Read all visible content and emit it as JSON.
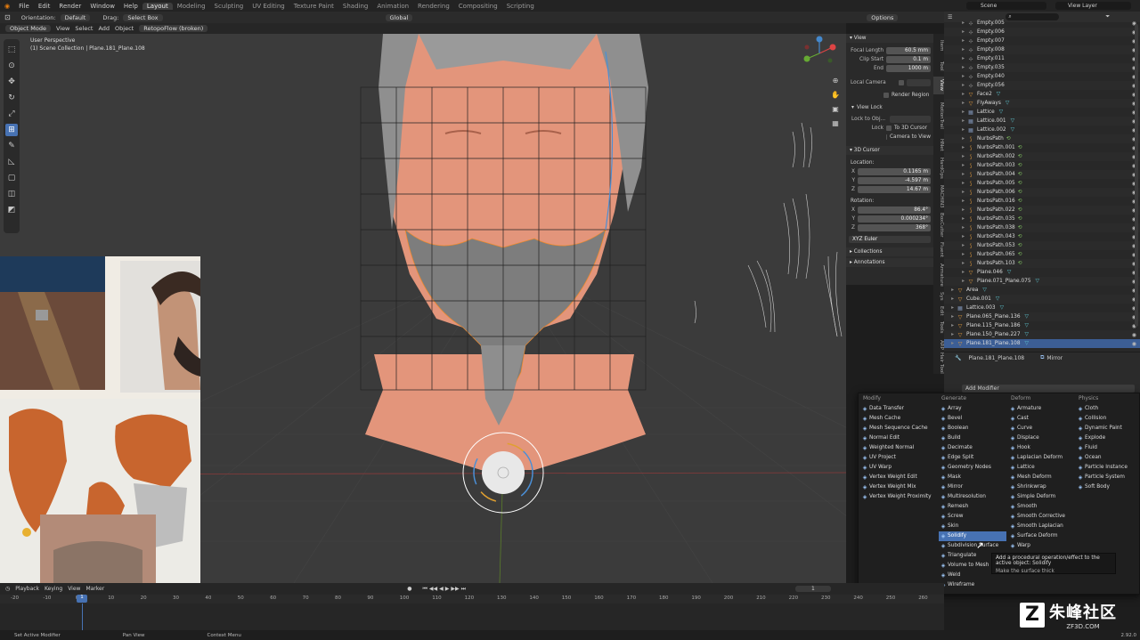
{
  "topbar": {
    "menus": [
      "File",
      "Edit",
      "Render",
      "Window",
      "Help"
    ],
    "workspaces": [
      "Layout",
      "Modeling",
      "Sculpting",
      "UV Editing",
      "Texture Paint",
      "Shading",
      "Animation",
      "Rendering",
      "Compositing",
      "Scripting"
    ],
    "active_workspace": "Layout",
    "scene": "Scene",
    "view_layer": "View Layer"
  },
  "header": {
    "orientation_label": "Orientation:",
    "orientation_value": "Default",
    "drag_label": "Drag:",
    "drag_value": "Select Box",
    "transform_space": "Global",
    "options": "Options"
  },
  "header2": {
    "mode": "Object Mode",
    "menus": [
      "View",
      "Select",
      "Add",
      "Object"
    ],
    "addon": "RetopoFlow (broken)"
  },
  "viewport": {
    "view_name": "User Perspective",
    "collection_info": "(1) Scene Collection | Plane.181_Plane.108"
  },
  "npanel": {
    "view_section": "View",
    "focal_length_label": "Focal Length",
    "focal_length": "60.5 mm",
    "clip_start_label": "Clip Start",
    "clip_start": "0.1 m",
    "clip_end_label": "End",
    "clip_end": "1000 m",
    "local_camera_label": "Local Camera",
    "render_region": "Render Region",
    "view_lock": "View Lock",
    "lock_to_obj_label": "Lock to Obj...",
    "lock_label": "Lock",
    "to_3d_cursor": "To 3D Cursor",
    "camera_to_view": "Camera to View",
    "cursor_section": "3D Cursor",
    "location_label": "Location:",
    "loc_x": "0.1165 m",
    "loc_y": "-4.597 m",
    "loc_z": "14.67 m",
    "rotation_label": "Rotation:",
    "rot_x": "86.4°",
    "rot_y": "0.000234°",
    "rot_z": "368°",
    "rotation_mode": "XYZ Euler",
    "collections": "Collections",
    "annotations": "Annotations"
  },
  "ntabs": [
    "Item",
    "Tool",
    "View",
    "MotionTrail",
    "HNet",
    "HardOps",
    "MACHIN3",
    "BoxCutter",
    "Fluent",
    "Armature",
    "Sys",
    "Edit",
    "Tools",
    "ARP",
    "Hair Tool"
  ],
  "outliner": {
    "items": [
      {
        "name": "Empty.005",
        "type": "empty"
      },
      {
        "name": "Empty.006",
        "type": "empty"
      },
      {
        "name": "Empty.007",
        "type": "empty"
      },
      {
        "name": "Empty.008",
        "type": "empty"
      },
      {
        "name": "Empty.011",
        "type": "empty"
      },
      {
        "name": "Empty.035",
        "type": "empty"
      },
      {
        "name": "Empty.040",
        "type": "empty"
      },
      {
        "name": "Empty.056",
        "type": "empty"
      },
      {
        "name": "Face2",
        "type": "mesh"
      },
      {
        "name": "FlyAways",
        "type": "mesh"
      },
      {
        "name": "Lattice",
        "type": "lattice"
      },
      {
        "name": "Lattice.001",
        "type": "lattice"
      },
      {
        "name": "Lattice.002",
        "type": "lattice"
      },
      {
        "name": "NurbsPath",
        "type": "curve"
      },
      {
        "name": "NurbsPath.001",
        "type": "curve"
      },
      {
        "name": "NurbsPath.002",
        "type": "curve"
      },
      {
        "name": "NurbsPath.003",
        "type": "curve"
      },
      {
        "name": "NurbsPath.004",
        "type": "curve"
      },
      {
        "name": "NurbsPath.005",
        "type": "curve"
      },
      {
        "name": "NurbsPath.006",
        "type": "curve"
      },
      {
        "name": "NurbsPath.016",
        "type": "curve"
      },
      {
        "name": "NurbsPath.022",
        "type": "curve"
      },
      {
        "name": "NurbsPath.035",
        "type": "curve"
      },
      {
        "name": "NurbsPath.038",
        "type": "curve"
      },
      {
        "name": "NurbsPath.043",
        "type": "curve"
      },
      {
        "name": "NurbsPath.053",
        "type": "curve"
      },
      {
        "name": "NurbsPath.065",
        "type": "curve"
      },
      {
        "name": "NurbsPath.103",
        "type": "curve"
      },
      {
        "name": "Plane.046",
        "type": "mesh"
      },
      {
        "name": "Plane.071_Plane.075",
        "type": "mesh"
      },
      {
        "name": "Area",
        "type": "mesh"
      },
      {
        "name": "Cube.001",
        "type": "mesh"
      },
      {
        "name": "Lattice.003",
        "type": "lattice"
      },
      {
        "name": "Plane.065_Plane.136",
        "type": "mesh"
      },
      {
        "name": "Plane.115_Plane.186",
        "type": "mesh"
      },
      {
        "name": "Plane.150_Plane.227",
        "type": "mesh"
      },
      {
        "name": "Plane.181_Plane.108",
        "type": "mesh",
        "selected": true
      }
    ]
  },
  "properties": {
    "object_name": "Plane.181_Plane.108",
    "modifier_name": "Mirror",
    "add_modifier": "Add Modifier"
  },
  "modifier_menu": {
    "modify": {
      "title": "Modify",
      "items": [
        "Data Transfer",
        "Mesh Cache",
        "Mesh Sequence Cache",
        "Normal Edit",
        "Weighted Normal",
        "UV Project",
        "UV Warp",
        "Vertex Weight Edit",
        "Vertex Weight Mix",
        "Vertex Weight Proximity"
      ]
    },
    "generate": {
      "title": "Generate",
      "items": [
        "Array",
        "Bevel",
        "Boolean",
        "Build",
        "Decimate",
        "Edge Split",
        "Geometry Nodes",
        "Mask",
        "Mirror",
        "Multiresolution",
        "Remesh",
        "Screw",
        "Skin",
        "Solidify",
        "Subdivision Surface",
        "Triangulate",
        "Volume to Mesh",
        "Weld",
        "Wireframe"
      ]
    },
    "deform": {
      "title": "Deform",
      "items": [
        "Armature",
        "Cast",
        "Curve",
        "Displace",
        "Hook",
        "Laplacian Deform",
        "Lattice",
        "Mesh Deform",
        "Shrinkwrap",
        "Simple Deform",
        "Smooth",
        "Smooth Corrective",
        "Smooth Laplacian",
        "Surface Deform",
        "Warp"
      ]
    },
    "physics": {
      "title": "Physics",
      "items": [
        "Cloth",
        "Collision",
        "Dynamic Paint",
        "Explode",
        "Fluid",
        "Ocean",
        "Particle Instance",
        "Particle System",
        "Soft Body"
      ]
    },
    "highlighted": "Solidify"
  },
  "tooltip": {
    "line1": "Add a procedural operation/effect to the active object:  Solidify",
    "line2": "Make the surface thick"
  },
  "timeline": {
    "menus": [
      "Playback",
      "Keying",
      "View",
      "Marker"
    ],
    "current_frame": "1",
    "ticks": [
      "-20",
      "-10",
      "0",
      "10",
      "20",
      "30",
      "40",
      "50",
      "60",
      "70",
      "80",
      "90",
      "100",
      "110",
      "120",
      "130",
      "140",
      "150",
      "160",
      "170",
      "180",
      "190",
      "200",
      "210",
      "220",
      "230",
      "240",
      "250",
      "260"
    ],
    "playhead": "1"
  },
  "statusbar": {
    "left": "Set Active Modifier",
    "middle": "Pan View",
    "right": "Context Menu",
    "version": "2.92.0"
  },
  "watermark": {
    "logo": "Z",
    "text": "朱峰社区",
    "sub": "ZF3D.COM"
  },
  "colors": {
    "accent": "#4772b3",
    "skin": "#e3957b",
    "hair": "#8a8a8a",
    "selection_orange": "#f08a2a"
  }
}
